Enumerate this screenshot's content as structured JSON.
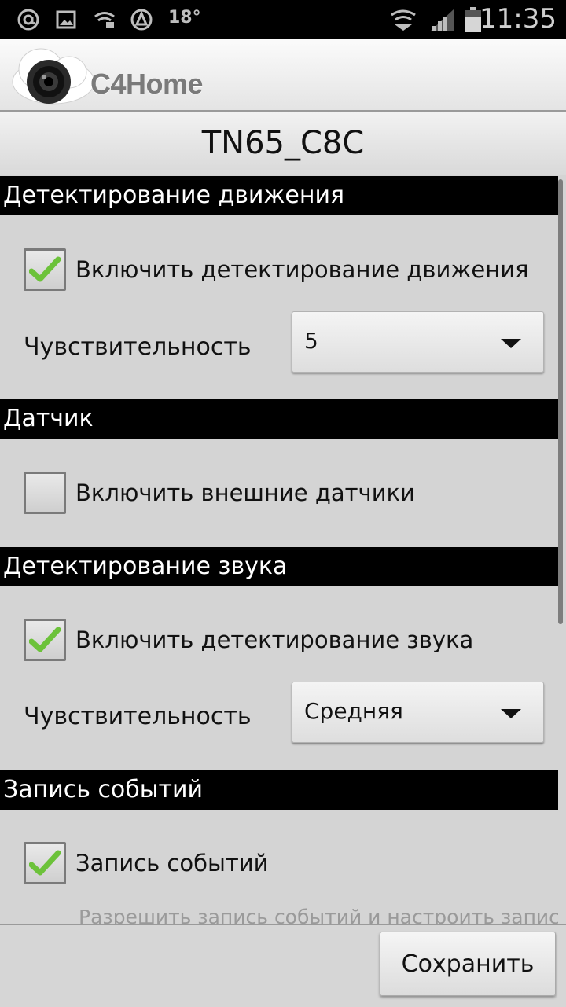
{
  "status_bar": {
    "time": "11:35",
    "temperature": "18°",
    "icons": [
      "at-icon",
      "image-icon",
      "wifi-icon",
      "avast-icon",
      "network-icon",
      "signal-icon",
      "battery-icon"
    ]
  },
  "app": {
    "brand": "C4Home"
  },
  "title": "TN65_C8C",
  "sections": {
    "motion": {
      "header": "Детектирование движения",
      "enable_label": "Включить детектирование движения",
      "enable_checked": true,
      "sensitivity_label": "Чувствительность",
      "sensitivity_value": "5"
    },
    "sensor": {
      "header": "Датчик",
      "enable_label": "Включить внешние датчики",
      "enable_checked": false
    },
    "sound": {
      "header": "Детектирование звука",
      "enable_label": "Включить детектирование звука",
      "enable_checked": true,
      "sensitivity_label": "Чувствительность",
      "sensitivity_value": "Средняя"
    },
    "events": {
      "header": "Запись событий",
      "enable_label": "Запись событий",
      "enable_checked": true,
      "description": "Разрешить запись событий и настроить запись"
    }
  },
  "save_button": "Сохранить",
  "colors": {
    "check_green": "#6cc23a",
    "header_bg": "#000000",
    "page_bg": "#d4d4d4"
  }
}
